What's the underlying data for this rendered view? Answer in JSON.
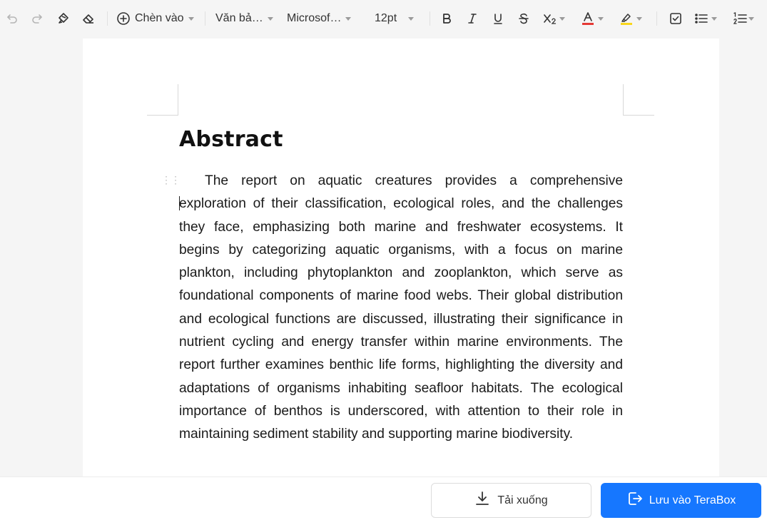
{
  "toolbar": {
    "insert_label": "Chèn vào",
    "style_label": "Văn bả…",
    "font_label": "Microsof…",
    "size_label": "12pt",
    "font_color": "#e53935",
    "highlight_color": "#f9d71c"
  },
  "document": {
    "title": "Abstract",
    "paragraph": "The report on aquatic creatures provides a comprehensive exploration of their classification, ecological roles, and the challenges they face, emphasizing both marine and freshwater ecosystems. It begins by categorizing aquatic organisms, with a focus on marine plankton, including phytoplankton and zooplankton, which serve as foundational components of marine food webs. Their global distribution and ecological functions are discussed, illustrating their significance in nutrient cycling and energy transfer within marine environments. The report further examines benthic life forms, highlighting the diversity and adaptations of organisms inhabiting seafloor habitats. The ecological importance of benthos is underscored, with attention to their role in maintaining sediment stability and supporting marine biodiversity."
  },
  "actions": {
    "download_label": "Tải xuống",
    "save_label": "Lưu vào TeraBox",
    "accent_color": "#1677ff"
  }
}
